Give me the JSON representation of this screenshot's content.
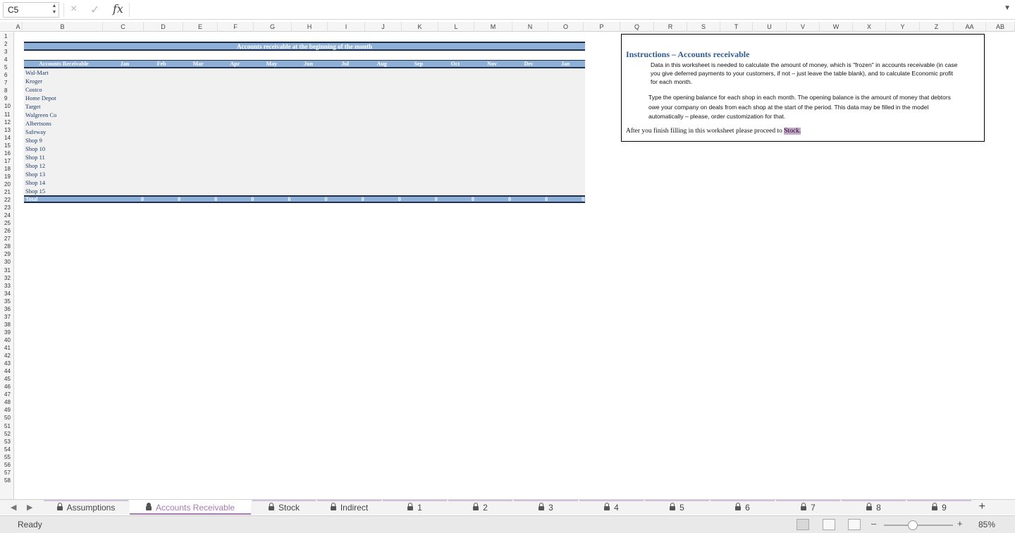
{
  "formula_bar": {
    "cell_reference": "C5",
    "cancel_icon": "×",
    "enter_icon": "✓",
    "fx_label": "fx",
    "formula": ""
  },
  "columns": [
    "A",
    "B",
    "C",
    "D",
    "E",
    "F",
    "G",
    "H",
    "I",
    "J",
    "K",
    "L",
    "M",
    "N",
    "O",
    "P",
    "Q",
    "R",
    "S",
    "T",
    "U",
    "V",
    "W",
    "X",
    "Y",
    "Z",
    "AA",
    "AB"
  ],
  "rows": [
    "1",
    "2",
    "3",
    "4",
    "5",
    "6",
    "7",
    "8",
    "9",
    "10",
    "11",
    "12",
    "13",
    "14",
    "15",
    "16",
    "17",
    "18",
    "19",
    "20",
    "21",
    "22",
    "23",
    "24",
    "25",
    "26",
    "27",
    "28",
    "29",
    "30",
    "31",
    "32",
    "33",
    "34",
    "35",
    "36",
    "37",
    "38",
    "39",
    "40",
    "41",
    "42",
    "43",
    "44",
    "45",
    "46",
    "47",
    "48",
    "49",
    "50",
    "51",
    "52",
    "53",
    "54",
    "55",
    "56",
    "57",
    "58"
  ],
  "table": {
    "title": "Accounts receivable at the beginning of the month",
    "header_label": "Accounts Receivable",
    "months": [
      "Jan",
      "Feb",
      "Mar",
      "Apr",
      "May",
      "Jun",
      "Jul",
      "Aug",
      "Sep",
      "Oct",
      "Nov",
      "Dec",
      "Jan"
    ],
    "shops": [
      "Wal-Mart",
      "Kroger",
      "Costco",
      "Home Depot",
      "Target",
      "Walgreen Co",
      "Albertsons",
      "Safeway",
      "Shop 9",
      "Shop 10",
      "Shop 11",
      "Shop 12",
      "Shop 13",
      "Shop 14",
      "Shop 15"
    ],
    "total_label": "Total",
    "totals": [
      "0",
      "0",
      "0",
      "0",
      "0",
      "0",
      "0",
      "0",
      "0",
      "0",
      "0",
      "0",
      "0"
    ]
  },
  "instructions": {
    "title": "Instructions – Accounts receivable",
    "para1": "Data in this worksheet is needed to calculate the amount of money, which is \"frozen\" in accounts receivable (in case you give deferred payments to your customers, if not – just leave the table blank), and to calculate Economic profit for each month.",
    "para2": "Type the opening balance for each shop in each month. The opening balance is the amount of money that debtors owe your company on deals from each shop at the start of the period. This data may be filled in the model automatically – please, order customization for that.",
    "para3_prefix": "After you finish filling in this worksheet please proceed to ",
    "para3_link": "Stock."
  },
  "sheet_tabs": [
    {
      "label": "Assumptions",
      "active": false
    },
    {
      "label": "Accounts Receivable",
      "active": true
    },
    {
      "label": "Stock",
      "active": false
    },
    {
      "label": "Indirect",
      "active": false
    },
    {
      "label": "1",
      "active": false
    },
    {
      "label": "2",
      "active": false
    },
    {
      "label": "3",
      "active": false
    },
    {
      "label": "4",
      "active": false
    },
    {
      "label": "5",
      "active": false
    },
    {
      "label": "6",
      "active": false
    },
    {
      "label": "7",
      "active": false
    },
    {
      "label": "8",
      "active": false
    },
    {
      "label": "9",
      "active": false
    }
  ],
  "add_sheet_icon": "+",
  "status_bar": {
    "status": "Ready",
    "zoom_minus": "–",
    "zoom_plus": "+",
    "zoom_level": "85%"
  },
  "colors": {
    "header_blue": "#8eafd6",
    "border_navy": "#1f2f4f",
    "instructions_title": "#2e5b8f",
    "active_tab": "#a57bb2",
    "link_highlight": "#c9a6cf"
  }
}
